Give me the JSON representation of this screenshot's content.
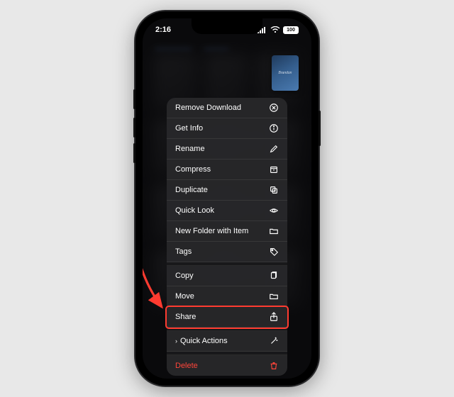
{
  "status_bar": {
    "time": "2:16",
    "battery_text": "100"
  },
  "thumbnail": {
    "label": "Brandon"
  },
  "menu": {
    "remove_download": "Remove Download",
    "get_info": "Get Info",
    "rename": "Rename",
    "compress": "Compress",
    "duplicate": "Duplicate",
    "quick_look": "Quick Look",
    "new_folder": "New Folder with Item",
    "tags": "Tags",
    "copy": "Copy",
    "move": "Move",
    "share": "Share",
    "quick_actions": "Quick Actions",
    "delete": "Delete"
  },
  "annotation": {
    "highlighted_item": "share"
  }
}
